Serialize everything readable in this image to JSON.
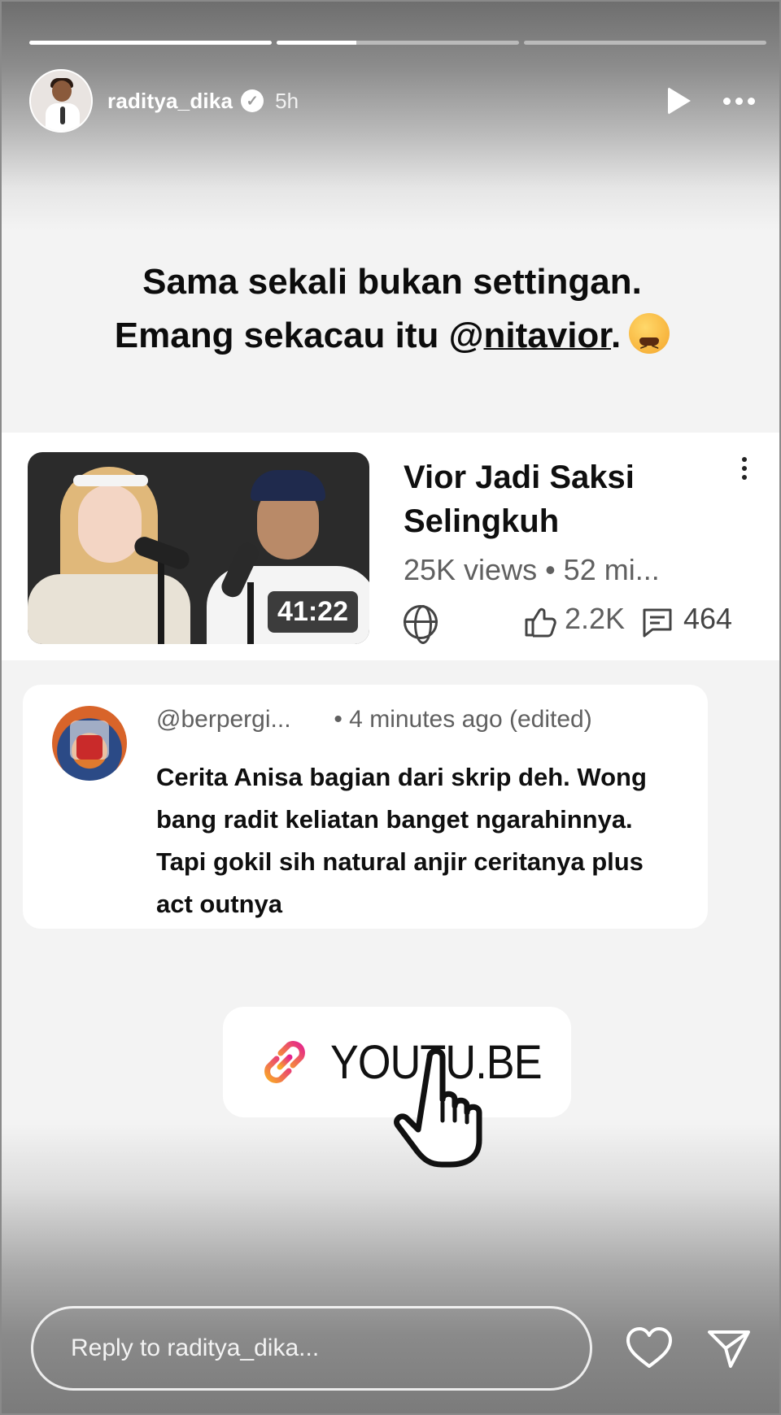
{
  "story": {
    "progress": [
      1.0,
      0.33,
      0.0
    ],
    "username": "raditya_dika",
    "verified_icon": "verified-badge-icon",
    "time_ago": "5h"
  },
  "caption": {
    "line1": "Sama sekali bukan settingan.",
    "line2_prefix": "Emang sekacau itu @",
    "mention": "nitavior",
    "line2_suffix": "."
  },
  "video": {
    "title": "Vior Jadi Saksi Selingkuh",
    "duration": "41:22",
    "meta": "25K views • 52 mi...",
    "likes": "2.2K",
    "comments": "464"
  },
  "comment": {
    "handle": "@berpergi...",
    "time": "• 4 minutes ago (edited)",
    "text": "Cerita Anisa bagian dari skrip deh. Wong bang radit keliatan banget ngarahinnya. Tapi gokil sih natural anjir ceritanya plus act outnya"
  },
  "link": {
    "label": "YOUTU.BE"
  },
  "reply": {
    "placeholder": "Reply to raditya_dika..."
  },
  "colors": {
    "link_gradient_start": "#f9a826",
    "link_gradient_end": "#e4238c"
  }
}
